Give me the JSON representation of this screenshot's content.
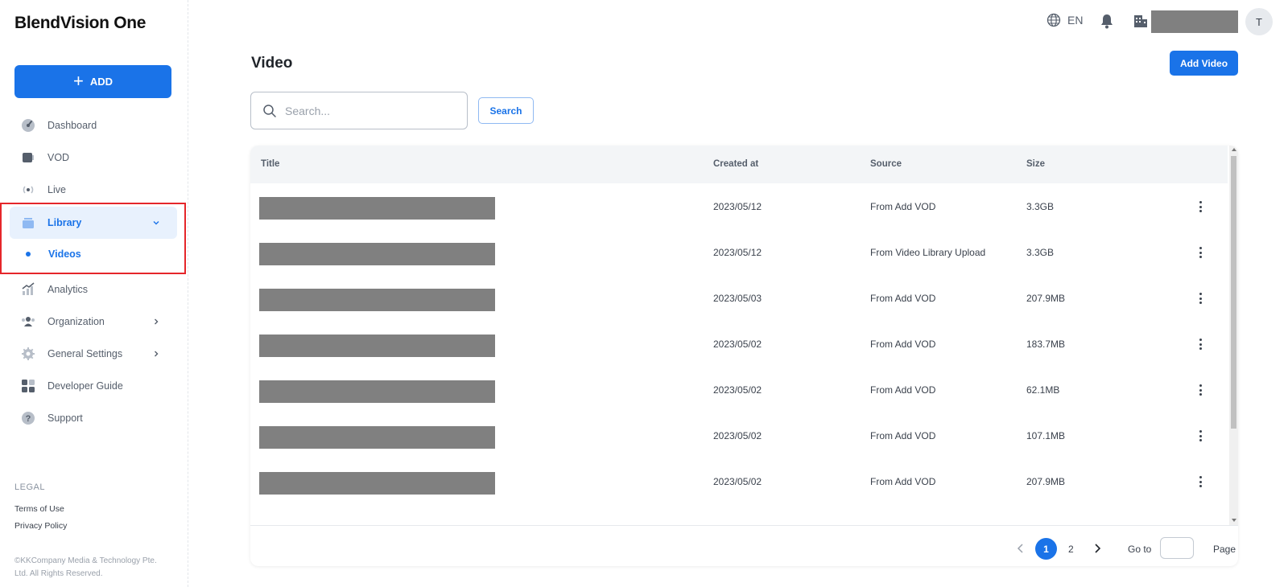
{
  "sidebar": {
    "brand": "BlendVision One",
    "add_label": "ADD",
    "items": [
      {
        "label": "Dashboard"
      },
      {
        "label": "VOD"
      },
      {
        "label": "Live"
      },
      {
        "label": "Library"
      },
      {
        "label": "Analytics"
      },
      {
        "label": "Organization"
      },
      {
        "label": "General Settings"
      },
      {
        "label": "Developer Guide"
      },
      {
        "label": "Support"
      }
    ],
    "sub_items": [
      {
        "label": "Videos"
      }
    ],
    "legal_title": "LEGAL",
    "legal_links": [
      "Terms of Use",
      "Privacy Policy"
    ],
    "copyright": "©KKCompany Media & Technology Pte. Ltd. All Rights Reserved."
  },
  "topbar": {
    "language": "EN",
    "avatar_initial": "T",
    "org_name_redacted": true
  },
  "main": {
    "title": "Video",
    "add_video_label": "Add Video",
    "search": {
      "placeholder": "Search...",
      "value": "",
      "button_label": "Search"
    },
    "table": {
      "columns": [
        "Title",
        "Created at",
        "Source",
        "Size"
      ],
      "rows": [
        {
          "title_redacted": true,
          "created_at": "2023/05/12",
          "source": "From Add VOD",
          "size": "3.3GB"
        },
        {
          "title_redacted": true,
          "created_at": "2023/05/12",
          "source": "From Video Library Upload",
          "size": "3.3GB"
        },
        {
          "title_redacted": true,
          "created_at": "2023/05/03",
          "source": "From Add VOD",
          "size": "207.9MB"
        },
        {
          "title_redacted": true,
          "created_at": "2023/05/02",
          "source": "From Add VOD",
          "size": "183.7MB"
        },
        {
          "title_redacted": true,
          "created_at": "2023/05/02",
          "source": "From Add VOD",
          "size": "62.1MB"
        },
        {
          "title_redacted": true,
          "created_at": "2023/05/02",
          "source": "From Add VOD",
          "size": "107.1MB"
        },
        {
          "title_redacted": true,
          "created_at": "2023/05/02",
          "source": "From Add VOD",
          "size": "207.9MB"
        }
      ]
    },
    "pagination": {
      "current": "1",
      "pages": [
        "1",
        "2"
      ],
      "goto_label": "Go to",
      "page_label": "Page",
      "goto_value": ""
    }
  },
  "colors": {
    "accent": "#1a73e8",
    "highlight": "#e5262a",
    "redaction": "#808080"
  }
}
